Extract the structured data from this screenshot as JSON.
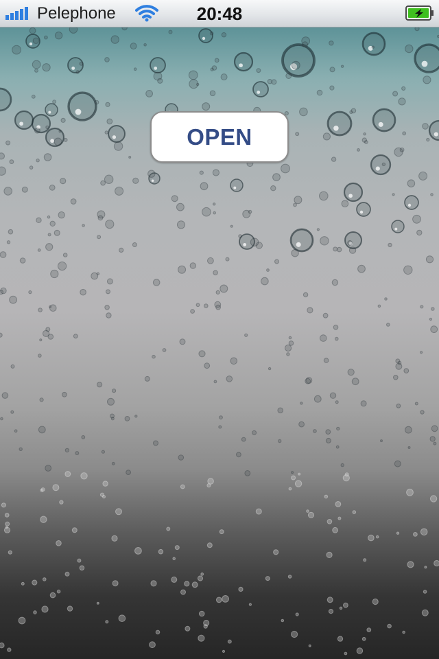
{
  "status_bar": {
    "carrier": "Pelephone",
    "time": "20:48",
    "signal_icon": "signal-bars-icon",
    "wifi_icon": "wifi-icon",
    "battery_icon": "battery-charging-icon",
    "battery_color": "#3fbf1f"
  },
  "main": {
    "open_button_label": "OPEN",
    "button_text_color": "#344c86"
  }
}
